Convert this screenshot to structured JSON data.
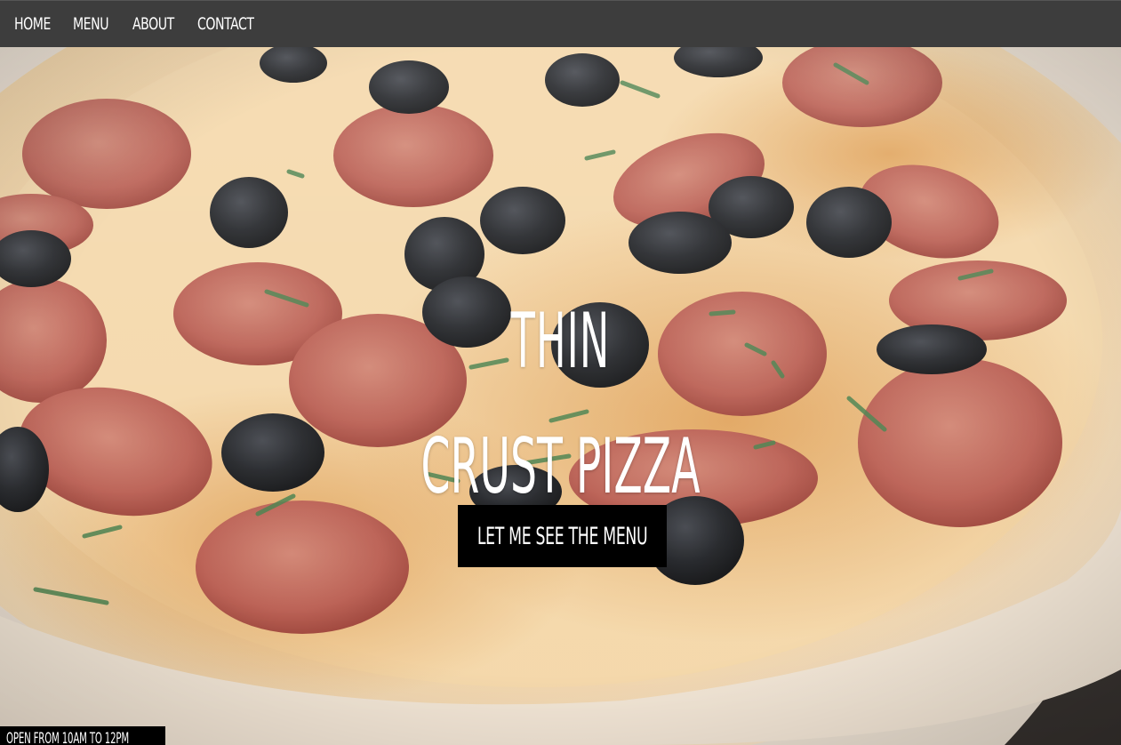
{
  "nav": {
    "items": [
      {
        "label": "Home"
      },
      {
        "label": "Menu"
      },
      {
        "label": "About"
      },
      {
        "label": "Contact"
      }
    ]
  },
  "hero": {
    "title_line1": "Thin",
    "title_line2": "Crust Pizza",
    "cta_label": "Let me see the menu",
    "image_subject": "pepperoni-olive-pizza-photo"
  },
  "hours": {
    "text": "Open from 10am to 12pm"
  },
  "colors": {
    "nav_bg": "#3d3d3d",
    "button_bg": "#000000",
    "text": "#ffffff"
  }
}
